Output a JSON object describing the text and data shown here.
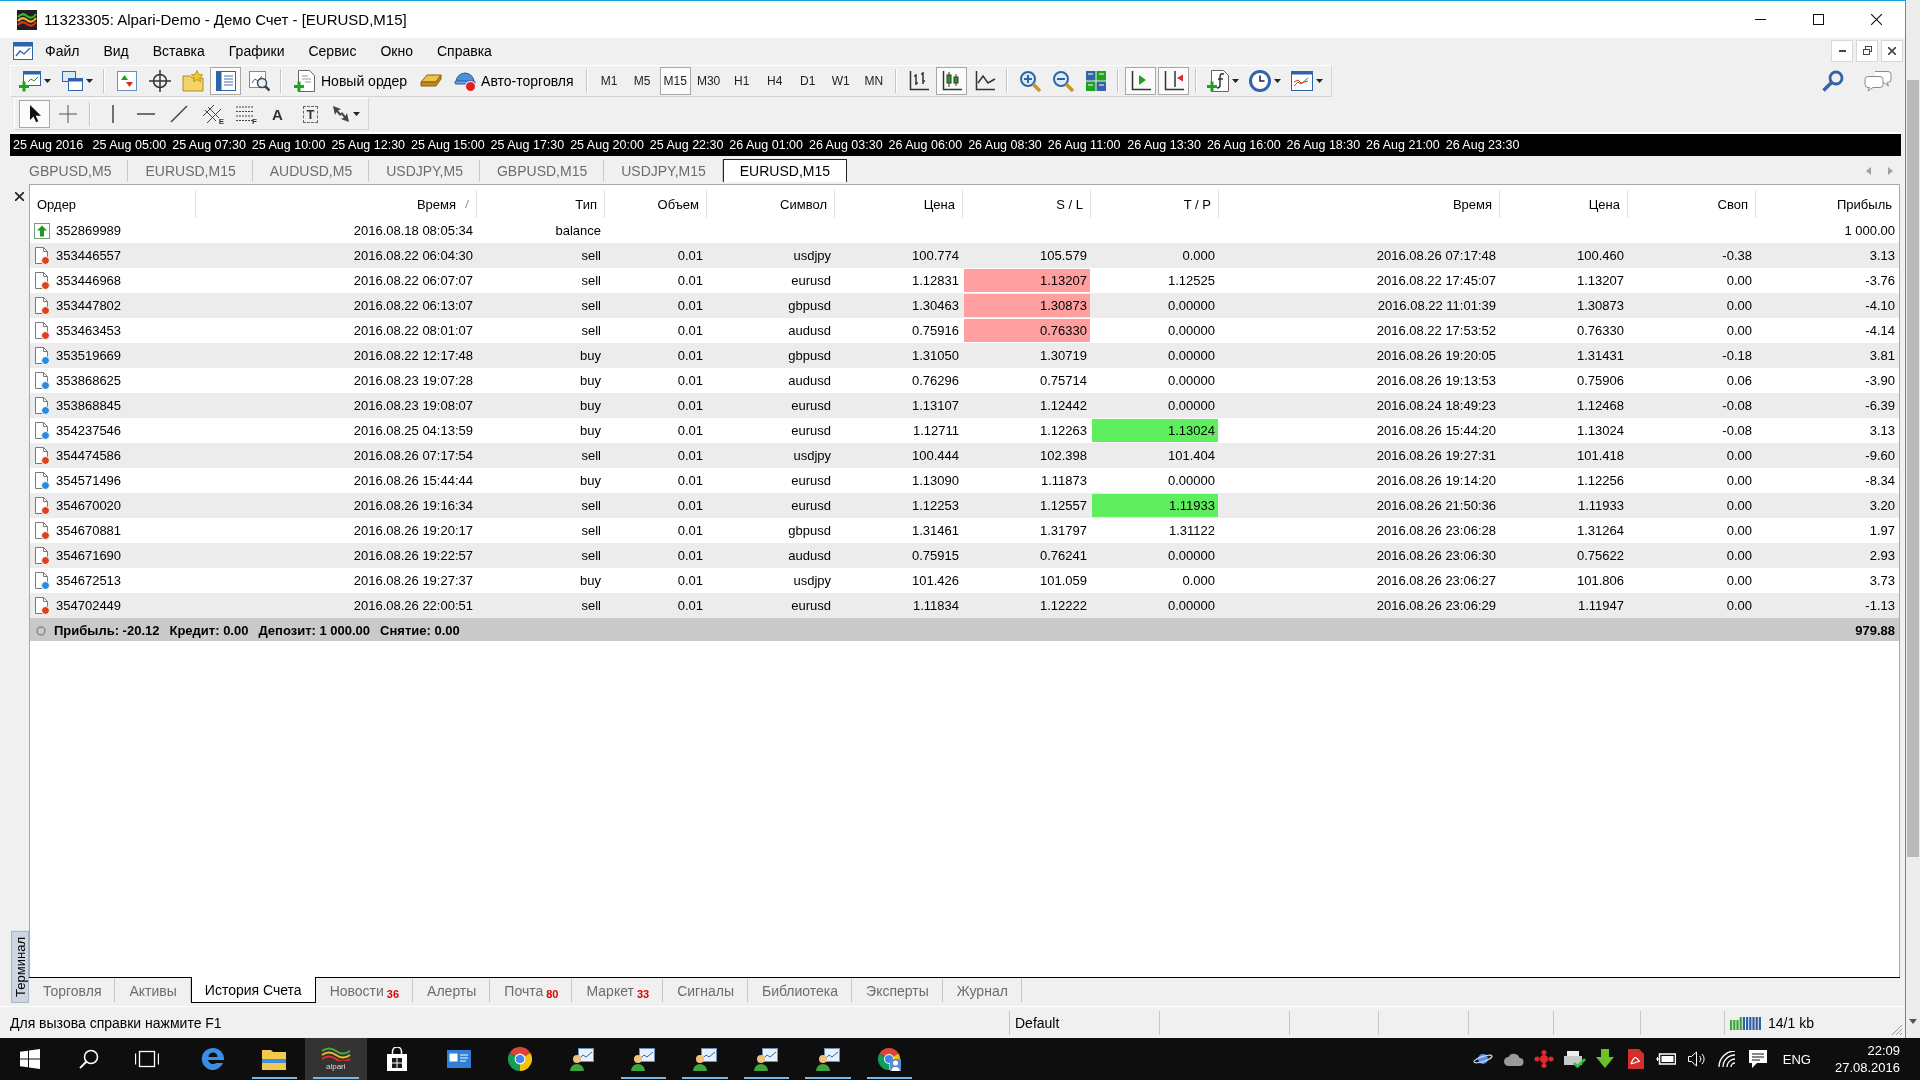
{
  "window": {
    "title": "11323305: Alpari-Demo - Демо Счет - [EURUSD,M15]"
  },
  "menu": [
    "Файл",
    "Вид",
    "Вставка",
    "Графики",
    "Сервис",
    "Окно",
    "Справка"
  ],
  "toolbar": {
    "view_toggles": [
      {
        "pressed": false
      },
      {
        "pressed": false
      },
      {
        "pressed": false
      },
      {
        "pressed": true
      },
      {
        "pressed": false
      }
    ],
    "new_order": "Новый ордер",
    "auto_trading": "Авто-торговля",
    "periods": [
      {
        "label": "M1",
        "selected": false
      },
      {
        "label": "M5",
        "selected": false
      },
      {
        "label": "M15",
        "selected": true
      },
      {
        "label": "M30",
        "selected": false
      },
      {
        "label": "H1",
        "selected": false
      },
      {
        "label": "H4",
        "selected": false
      },
      {
        "label": "D1",
        "selected": false
      },
      {
        "label": "W1",
        "selected": false
      },
      {
        "label": "MN",
        "selected": false
      }
    ],
    "chart_modes": [
      {
        "selected": false
      },
      {
        "selected": true
      },
      {
        "selected": false
      }
    ],
    "chart_toggles": [
      {
        "pressed": true
      },
      {
        "pressed": true
      }
    ]
  },
  "drawing_tools": [
    {
      "selected": true
    },
    {
      "selected": false
    },
    {
      "selected": false
    },
    {
      "selected": false
    },
    {
      "selected": false
    },
    {
      "selected": false,
      "mark": "E"
    },
    {
      "selected": false,
      "mark": "F"
    },
    {
      "selected": false,
      "glyph": "A"
    },
    {
      "selected": false,
      "glyph": "T"
    },
    {
      "selected": false
    }
  ],
  "time_axis": [
    "25 Aug 2016",
    "25 Aug 05:00",
    "25 Aug 07:30",
    "25 Aug 10:00",
    "25 Aug 12:30",
    "25 Aug 15:00",
    "25 Aug 17:30",
    "25 Aug 20:00",
    "25 Aug 22:30",
    "26 Aug 01:00",
    "26 Aug 03:30",
    "26 Aug 06:00",
    "26 Aug 08:30",
    "26 Aug 11:00",
    "26 Aug 13:30",
    "26 Aug 16:00",
    "26 Aug 18:30",
    "26 Aug 21:00",
    "26 Aug 23:30"
  ],
  "chart_tabs": [
    {
      "label": "GBPUSD,M5",
      "selected": false
    },
    {
      "label": "EURUSD,M15",
      "selected": false
    },
    {
      "label": "AUDUSD,M5",
      "selected": false
    },
    {
      "label": "USDJPY,M5",
      "selected": false
    },
    {
      "label": "GBPUSD,M15",
      "selected": false
    },
    {
      "label": "USDJPY,M15",
      "selected": false
    },
    {
      "label": "EURUSD,M15",
      "selected": true
    }
  ],
  "terminal": {
    "label": "Терминал",
    "columns": [
      {
        "label": "Ордер",
        "sorted": false
      },
      {
        "label": "Время",
        "sorted": true
      },
      {
        "label": "Тип",
        "sorted": false
      },
      {
        "label": "Объем",
        "sorted": false
      },
      {
        "label": "Символ",
        "sorted": false
      },
      {
        "label": "Цена",
        "sorted": false
      },
      {
        "label": "S / L",
        "sorted": false
      },
      {
        "label": "T / P",
        "sorted": false
      },
      {
        "label": "Время",
        "sorted": false
      },
      {
        "label": "Цена",
        "sorted": false
      },
      {
        "label": "Своп",
        "sorted": false
      },
      {
        "label": "Прибыль",
        "sorted": false
      }
    ],
    "rows": [
      {
        "kind": "balance",
        "order": "352869989",
        "open_time": "2016.08.18 08:05:34",
        "type": "balance",
        "profit": "1 000.00"
      },
      {
        "kind": "sell",
        "order": "353446557",
        "open_time": "2016.08.22 06:04:30",
        "type": "sell",
        "volume": "0.01",
        "symbol": "usdjpy",
        "open_price": "100.774",
        "sl": "105.579",
        "tp": "0.000",
        "close_time": "2016.08.26 07:17:48",
        "close_price": "100.460",
        "swap": "-0.38",
        "profit": "3.13",
        "sl_hit": false,
        "tp_hit": false
      },
      {
        "kind": "sell",
        "order": "353446968",
        "open_time": "2016.08.22 06:07:07",
        "type": "sell",
        "volume": "0.01",
        "symbol": "eurusd",
        "open_price": "1.12831",
        "sl": "1.13207",
        "tp": "1.12525",
        "close_time": "2016.08.22 17:45:07",
        "close_price": "1.13207",
        "swap": "0.00",
        "profit": "-3.76",
        "sl_hit": true,
        "tp_hit": false
      },
      {
        "kind": "sell",
        "order": "353447802",
        "open_time": "2016.08.22 06:13:07",
        "type": "sell",
        "volume": "0.01",
        "symbol": "gbpusd",
        "open_price": "1.30463",
        "sl": "1.30873",
        "tp": "0.00000",
        "close_time": "2016.08.22 11:01:39",
        "close_price": "1.30873",
        "swap": "0.00",
        "profit": "-4.10",
        "sl_hit": true,
        "tp_hit": false
      },
      {
        "kind": "sell",
        "order": "353463453",
        "open_time": "2016.08.22 08:01:07",
        "type": "sell",
        "volume": "0.01",
        "symbol": "audusd",
        "open_price": "0.75916",
        "sl": "0.76330",
        "tp": "0.00000",
        "close_time": "2016.08.22 17:53:52",
        "close_price": "0.76330",
        "swap": "0.00",
        "profit": "-4.14",
        "sl_hit": true,
        "tp_hit": false
      },
      {
        "kind": "buy",
        "order": "353519669",
        "open_time": "2016.08.22 12:17:48",
        "type": "buy",
        "volume": "0.01",
        "symbol": "gbpusd",
        "open_price": "1.31050",
        "sl": "1.30719",
        "tp": "0.00000",
        "close_time": "2016.08.26 19:20:05",
        "close_price": "1.31431",
        "swap": "-0.18",
        "profit": "3.81",
        "sl_hit": false,
        "tp_hit": false
      },
      {
        "kind": "buy",
        "order": "353868625",
        "open_time": "2016.08.23 19:07:28",
        "type": "buy",
        "volume": "0.01",
        "symbol": "audusd",
        "open_price": "0.76296",
        "sl": "0.75714",
        "tp": "0.00000",
        "close_time": "2016.08.26 19:13:53",
        "close_price": "0.75906",
        "swap": "0.06",
        "profit": "-3.90",
        "sl_hit": false,
        "tp_hit": false
      },
      {
        "kind": "buy",
        "order": "353868845",
        "open_time": "2016.08.23 19:08:07",
        "type": "buy",
        "volume": "0.01",
        "symbol": "eurusd",
        "open_price": "1.13107",
        "sl": "1.12442",
        "tp": "0.00000",
        "close_time": "2016.08.24 18:49:23",
        "close_price": "1.12468",
        "swap": "-0.08",
        "profit": "-6.39",
        "sl_hit": false,
        "tp_hit": false
      },
      {
        "kind": "buy",
        "order": "354237546",
        "open_time": "2016.08.25 04:13:59",
        "type": "buy",
        "volume": "0.01",
        "symbol": "eurusd",
        "open_price": "1.12711",
        "sl": "1.12263",
        "tp": "1.13024",
        "close_time": "2016.08.26 15:44:20",
        "close_price": "1.13024",
        "swap": "-0.08",
        "profit": "3.13",
        "sl_hit": false,
        "tp_hit": true
      },
      {
        "kind": "sell",
        "order": "354474586",
        "open_time": "2016.08.26 07:17:54",
        "type": "sell",
        "volume": "0.01",
        "symbol": "usdjpy",
        "open_price": "100.444",
        "sl": "102.398",
        "tp": "101.404",
        "close_time": "2016.08.26 19:27:31",
        "close_price": "101.418",
        "swap": "0.00",
        "profit": "-9.60",
        "sl_hit": false,
        "tp_hit": false
      },
      {
        "kind": "buy",
        "order": "354571496",
        "open_time": "2016.08.26 15:44:44",
        "type": "buy",
        "volume": "0.01",
        "symbol": "eurusd",
        "open_price": "1.13090",
        "sl": "1.11873",
        "tp": "0.00000",
        "close_time": "2016.08.26 19:14:20",
        "close_price": "1.12256",
        "swap": "0.00",
        "profit": "-8.34",
        "sl_hit": false,
        "tp_hit": false
      },
      {
        "kind": "sell",
        "order": "354670020",
        "open_time": "2016.08.26 19:16:34",
        "type": "sell",
        "volume": "0.01",
        "symbol": "eurusd",
        "open_price": "1.12253",
        "sl": "1.12557",
        "tp": "1.11933",
        "close_time": "2016.08.26 21:50:36",
        "close_price": "1.11933",
        "swap": "0.00",
        "profit": "3.20",
        "sl_hit": false,
        "tp_hit": true
      },
      {
        "kind": "sell",
        "order": "354670881",
        "open_time": "2016.08.26 19:20:17",
        "type": "sell",
        "volume": "0.01",
        "symbol": "gbpusd",
        "open_price": "1.31461",
        "sl": "1.31797",
        "tp": "1.31122",
        "close_time": "2016.08.26 23:06:28",
        "close_price": "1.31264",
        "swap": "0.00",
        "profit": "1.97",
        "sl_hit": false,
        "tp_hit": false
      },
      {
        "kind": "sell",
        "order": "354671690",
        "open_time": "2016.08.26 19:22:57",
        "type": "sell",
        "volume": "0.01",
        "symbol": "audusd",
        "open_price": "0.75915",
        "sl": "0.76241",
        "tp": "0.00000",
        "close_time": "2016.08.26 23:06:30",
        "close_price": "0.75622",
        "swap": "0.00",
        "profit": "2.93",
        "sl_hit": false,
        "tp_hit": false
      },
      {
        "kind": "buy",
        "order": "354672513",
        "open_time": "2016.08.26 19:27:37",
        "type": "buy",
        "volume": "0.01",
        "symbol": "usdjpy",
        "open_price": "101.426",
        "sl": "101.059",
        "tp": "0.000",
        "close_time": "2016.08.26 23:06:27",
        "close_price": "101.806",
        "swap": "0.00",
        "profit": "3.73",
        "sl_hit": false,
        "tp_hit": false
      },
      {
        "kind": "sell",
        "order": "354702449",
        "open_time": "2016.08.26 22:00:51",
        "type": "sell",
        "volume": "0.01",
        "symbol": "eurusd",
        "open_price": "1.11834",
        "sl": "1.12222",
        "tp": "0.00000",
        "close_time": "2016.08.26 23:06:29",
        "close_price": "1.11947",
        "swap": "0.00",
        "profit": "-1.13",
        "sl_hit": false,
        "tp_hit": false
      }
    ],
    "summary": {
      "items": [
        "Прибыль: -20.12",
        "Кредит: 0.00",
        "Депозит: 1 000.00",
        "Снятие: 0.00"
      ],
      "total": "979.88"
    },
    "tabs": [
      {
        "label": "Торговля",
        "selected": false
      },
      {
        "label": "Активы",
        "selected": false
      },
      {
        "label": "История Счета",
        "selected": true
      },
      {
        "label": "Новости",
        "badge": "36",
        "selected": false
      },
      {
        "label": "Алерты",
        "selected": false
      },
      {
        "label": "Почта",
        "badge": "80",
        "selected": false
      },
      {
        "label": "Маркет",
        "badge": "33",
        "selected": false
      },
      {
        "label": "Сигналы",
        "selected": false
      },
      {
        "label": "Библиотека",
        "selected": false
      },
      {
        "label": "Эксперты",
        "selected": false
      },
      {
        "label": "Журнал",
        "selected": false
      }
    ]
  },
  "status_bar": {
    "help": "Для вызова справки нажмите F1",
    "profile": "Default",
    "traffic": "14/1 kb"
  },
  "taskbar": {
    "apps": [
      {
        "running": false,
        "active": false
      },
      {
        "running": true,
        "active": false
      },
      {
        "running": true,
        "active": true,
        "logo_text": "alpari"
      },
      {
        "running": false,
        "active": false
      },
      {
        "running": false,
        "active": false
      },
      {
        "running": false,
        "active": false
      },
      {
        "running": false,
        "active": false
      },
      {
        "running": true,
        "active": false
      },
      {
        "running": true,
        "active": false
      },
      {
        "running": true,
        "active": false
      },
      {
        "running": true,
        "active": false
      },
      {
        "running": true,
        "active": false
      }
    ],
    "language": "ENG",
    "time": "22:09",
    "date": "27.08.2016"
  }
}
